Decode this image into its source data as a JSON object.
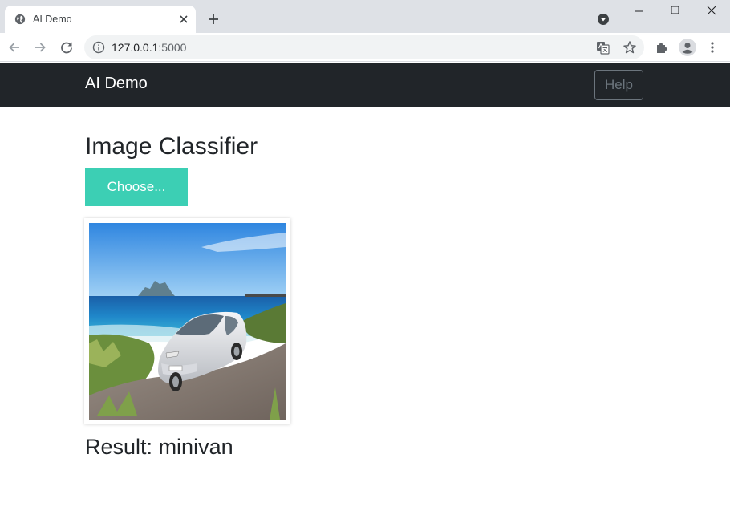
{
  "browser": {
    "tab_title": "AI Demo",
    "url_host": "127.0.0.1",
    "url_port": ":5000"
  },
  "navbar": {
    "brand": "AI Demo",
    "help_label": "Help"
  },
  "main": {
    "heading": "Image Classifier",
    "choose_label": "Choose...",
    "result_prefix": "Result:",
    "result_value": "minivan"
  },
  "colors": {
    "navbar_bg": "#212529",
    "accent": "#3ccfb4",
    "help_border": "#6c757d"
  },
  "icons": {
    "favicon": "globe-icon",
    "back": "arrow-left-icon",
    "forward": "arrow-right-icon",
    "reload": "reload-icon",
    "site_info": "info-icon",
    "translate": "translate-icon",
    "bookmark": "star-icon",
    "extensions": "puzzle-icon",
    "profile": "profile-icon",
    "menu": "kebab-menu-icon"
  }
}
